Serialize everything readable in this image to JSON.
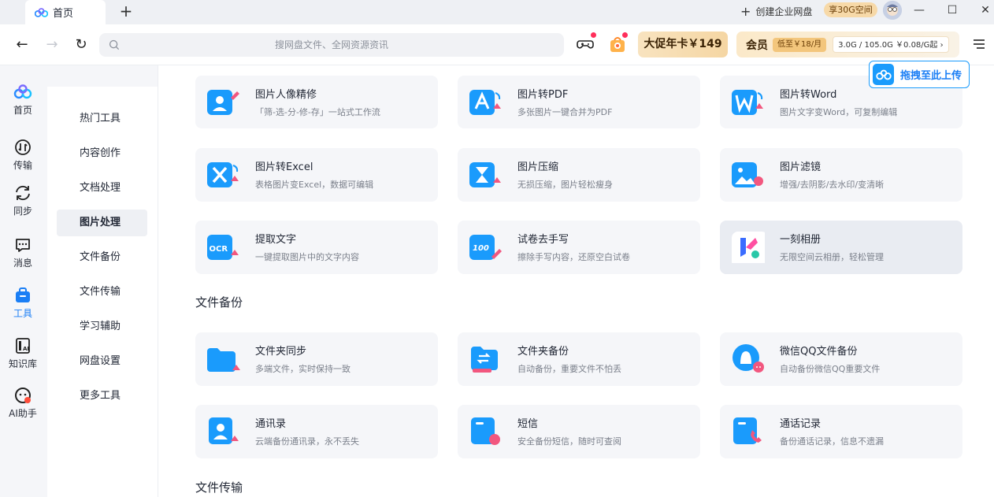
{
  "titlebar": {
    "tab_label": "首页",
    "new_tab": "+",
    "create_enterprise": "创建企业网盘",
    "enjoy_badge": "享30G空间",
    "minimize": "—",
    "maximize": "☐",
    "close": "✕"
  },
  "toolbar": {
    "back": "←",
    "forward": "→",
    "refresh": "↻",
    "search_placeholder": "搜网盘文件、全网资源资讯",
    "promo_label": "大促年卡￥149",
    "member_label": "会员",
    "member_price": "低至￥18/月",
    "storage": "3.0G / 105.0G  ￥0.08/G起 ›"
  },
  "upload": {
    "label": "拖拽至此上传"
  },
  "rail": [
    {
      "label": "首页",
      "icon": "home-cloud-icon"
    },
    {
      "label": "传输",
      "icon": "transfer-icon"
    },
    {
      "label": "同步",
      "icon": "sync-icon"
    },
    {
      "label": "消息",
      "icon": "message-icon"
    },
    {
      "label": "工具",
      "icon": "tools-bag-icon"
    },
    {
      "label": "知识库",
      "icon": "knowledge-base-icon"
    },
    {
      "label": "AI助手",
      "icon": "ai-assistant-icon"
    }
  ],
  "categories": [
    "热门工具",
    "内容创作",
    "文档处理",
    "图片处理",
    "文件备份",
    "文件传输",
    "学习辅助",
    "网盘设置",
    "更多工具"
  ],
  "active_category": "图片处理",
  "active_rail": "工具",
  "image_tools": [
    {
      "title": "图片人像精修",
      "desc": "「筛-选-分-修-存」一站式工作流",
      "icon": "portrait-retouch-icon"
    },
    {
      "title": "图片转PDF",
      "desc": "多张图片一键合并为PDF",
      "icon": "image-to-pdf-icon"
    },
    {
      "title": "图片转Word",
      "desc": "图片文字变Word，可复制编辑",
      "icon": "image-to-word-icon"
    },
    {
      "title": "图片转Excel",
      "desc": "表格图片变Excel，数据可编辑",
      "icon": "image-to-excel-icon"
    },
    {
      "title": "图片压缩",
      "desc": "无损压缩，图片轻松瘦身",
      "icon": "image-compress-icon"
    },
    {
      "title": "图片滤镜",
      "desc": "增强/去阴影/去水印/变清晰",
      "icon": "image-filter-icon"
    },
    {
      "title": "提取文字",
      "desc": "一键提取图片中的文字内容",
      "icon": "ocr-icon"
    },
    {
      "title": "试卷去手写",
      "desc": "擦除手写内容，还原空白试卷",
      "icon": "exam-erase-icon"
    },
    {
      "title": "一刻相册",
      "desc": "无限空间云相册，轻松管理",
      "icon": "yike-album-icon"
    }
  ],
  "section_backup": "文件备份",
  "backup_tools": [
    {
      "title": "文件夹同步",
      "desc": "多端文件，实时保持一致",
      "icon": "folder-sync-icon"
    },
    {
      "title": "文件夹备份",
      "desc": "自动备份，重要文件不怕丢",
      "icon": "folder-backup-icon"
    },
    {
      "title": "微信QQ文件备份",
      "desc": "自动备份微信QQ重要文件",
      "icon": "wechat-qq-backup-icon"
    },
    {
      "title": "通讯录",
      "desc": "云端备份通讯录，永不丢失",
      "icon": "contacts-icon"
    },
    {
      "title": "短信",
      "desc": "安全备份短信，随时可查阅",
      "icon": "sms-icon"
    },
    {
      "title": "通话记录",
      "desc": "备份通话记录，信息不遗漏",
      "icon": "call-log-icon"
    }
  ],
  "section_transfer": "文件传输",
  "colors": {
    "accent": "#1a7ef5",
    "card_bg": "#f5f6f9",
    "icon_blue": "#1a9bfc",
    "icon_pink": "#f2577f"
  }
}
